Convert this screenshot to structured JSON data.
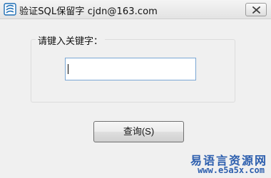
{
  "window": {
    "title": "验证SQL保留字   cjdn@163.com",
    "close_icon": "close-icon",
    "app_icon": "app-icon"
  },
  "form": {
    "group_label": "请键入关键字：",
    "keyword_value": "",
    "search_button_label": "查询(S)"
  },
  "watermark": {
    "chinese": "易语言资源网",
    "url": "www.e5a5x.com"
  },
  "colors": {
    "input_border": "#7aa7d4",
    "watermark": "#2d5fae"
  }
}
